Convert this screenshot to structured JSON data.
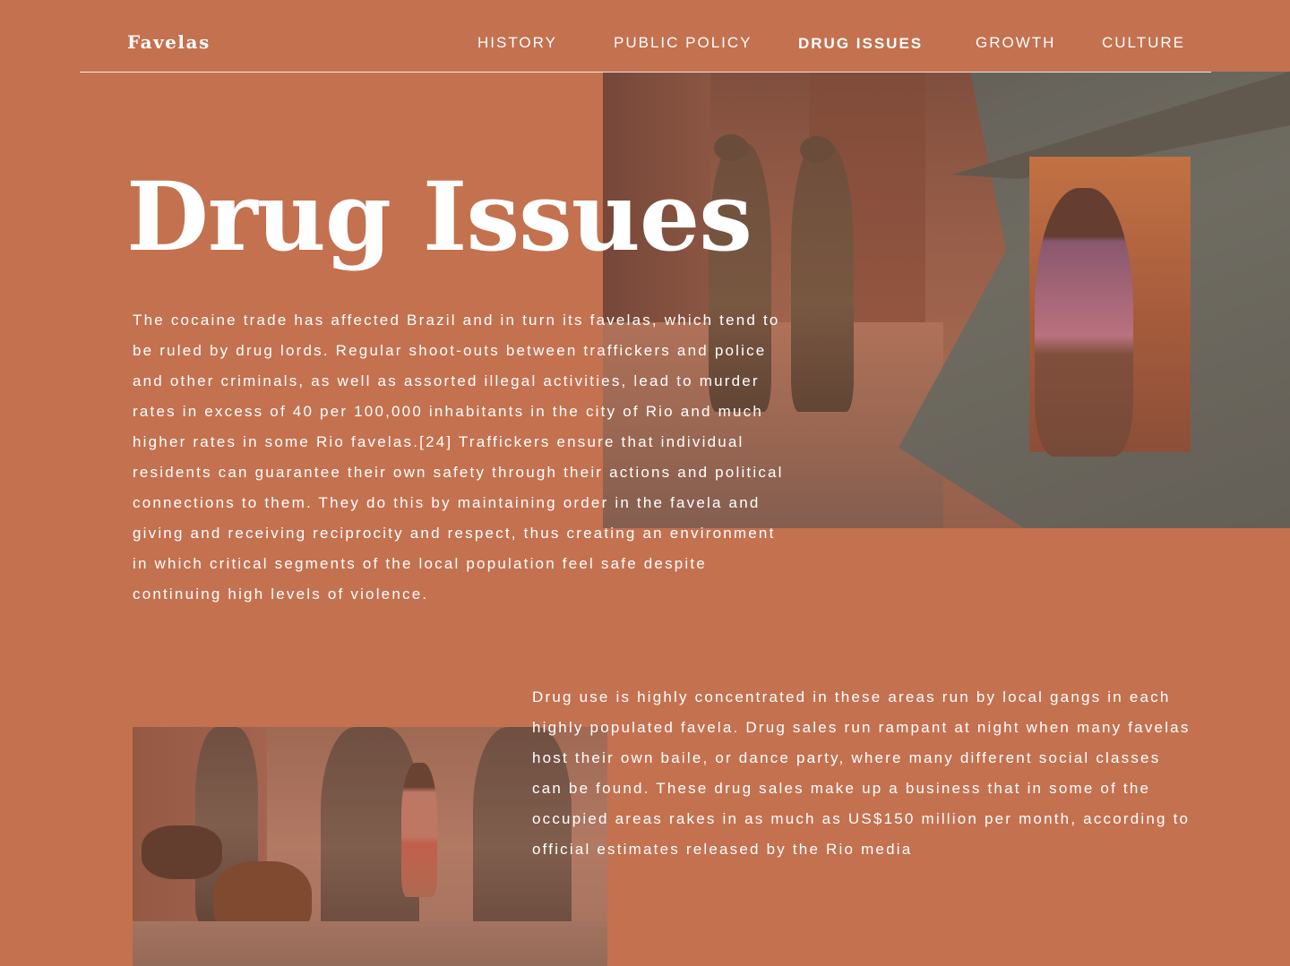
{
  "site": {
    "logo": "Favelas"
  },
  "nav": {
    "items": [
      {
        "label": "HISTORY",
        "active": false
      },
      {
        "label": "PUBLIC POLICY",
        "active": false
      },
      {
        "label": "DRUG ISSUES",
        "active": true
      },
      {
        "label": "GROWTH",
        "active": false
      },
      {
        "label": "CULTURE",
        "active": false
      }
    ]
  },
  "main": {
    "title": "Drug Issues",
    "paragraph_1": "The cocaine trade has affected Brazil and in turn its favelas, which tend to be ruled by drug lords. Regular shoot-outs between traffickers and police and other criminals, as well as assorted illegal activities, lead to murder rates in excess of 40 per 100,000 inhabitants in the city of Rio and much higher rates in some Rio favelas.[24] Traffickers ensure that individual residents can guarantee their own safety through their actions and political connections to them. They do this by maintaining order in the favela and giving and receiving reciprocity and respect, thus creating an environment in which critical segments of the local population feel safe despite continuing high levels of violence.",
    "paragraph_2": "Drug use is highly concentrated in these areas run by local gangs in each highly populated favela. Drug sales run rampant at night when many favelas host their own baile, or dance party, where many different social classes can be found. These drug sales make up a business that in some of the occupied areas rakes in as much as US$150 million per month, according to official estimates released by the Rio media"
  },
  "colors": {
    "background": "#c47150",
    "text": "#ffffff"
  }
}
